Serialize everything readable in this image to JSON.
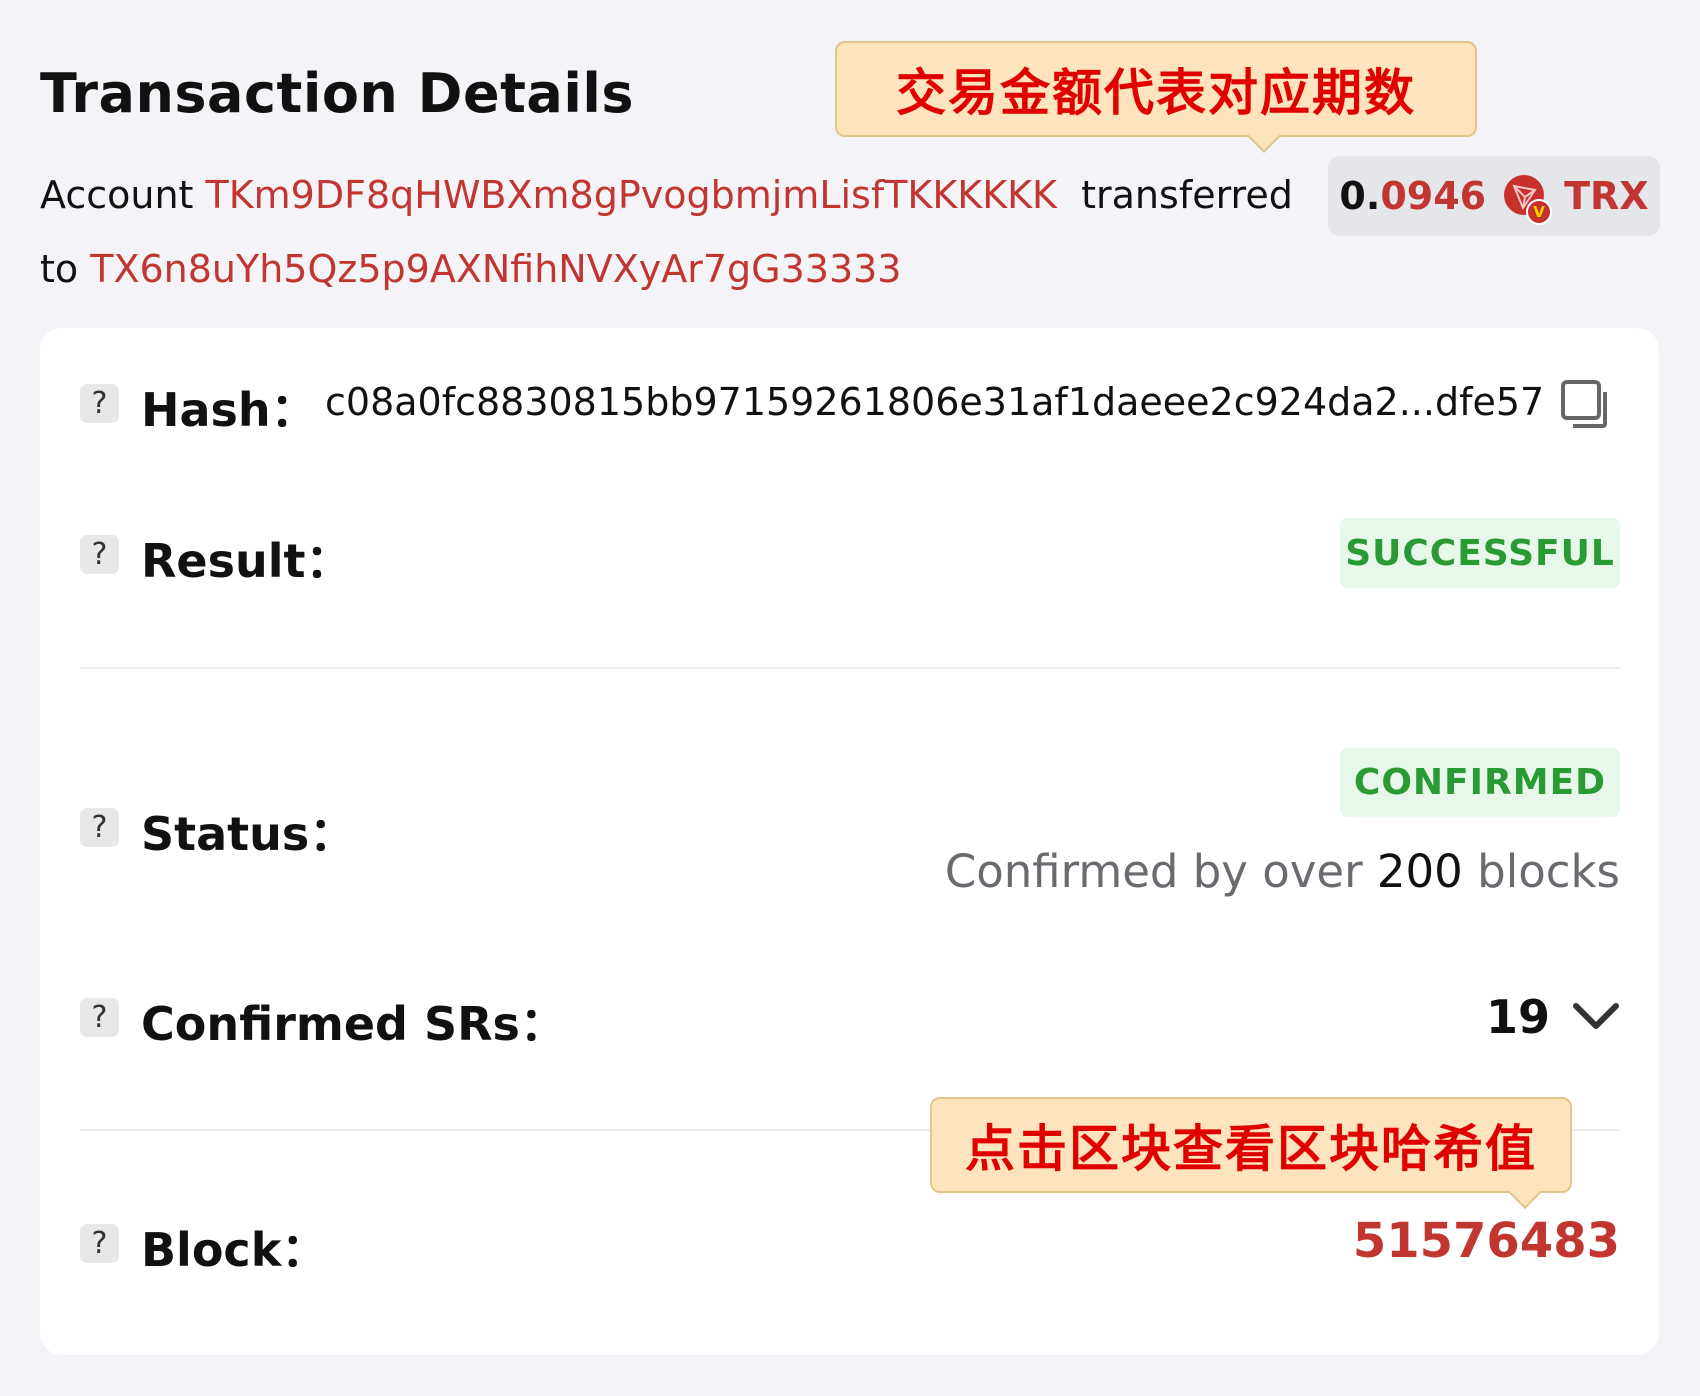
{
  "header": {
    "title": "Transaction Details"
  },
  "summary": {
    "account_label": "Account",
    "from_address": "TKm9DF8qHWBXm8gPvogbmjmLisfTKKKKKK",
    "transferred_label": "transferred",
    "amount_int": "0.",
    "amount_dec": "0946",
    "token_icon": "tron-icon",
    "token_badge": "V",
    "token": "TRX",
    "to_label": "to",
    "to_address": "TX6n8uYh5Qz5p9AXNfihNVXyAr7gG33333"
  },
  "annotations": {
    "amount_note": "交易金额代表对应期数",
    "block_note": "点击区块查看区块哈希值"
  },
  "details": {
    "hash": {
      "label": "Hash：",
      "value": "c08a0fc8830815bb97159261806e31af1daeee2c924da2...dfe57",
      "icon": "copy-icon"
    },
    "result": {
      "label": "Result：",
      "value": "SUCCESSFUL"
    },
    "status": {
      "label": "Status：",
      "value": "CONFIRMED",
      "note_prefix": "Confirmed by over",
      "note_count": "200",
      "note_suffix": "blocks"
    },
    "confirmed_srs": {
      "label": "Confirmed SRs：",
      "value": "19"
    },
    "block": {
      "label": "Block：",
      "value": "51576483"
    }
  },
  "help_icon_text": "?",
  "colors": {
    "accent_red": "#c23631",
    "success_green": "#2a9a35",
    "note_red": "#e00000",
    "note_bg": "#fee4bd"
  }
}
